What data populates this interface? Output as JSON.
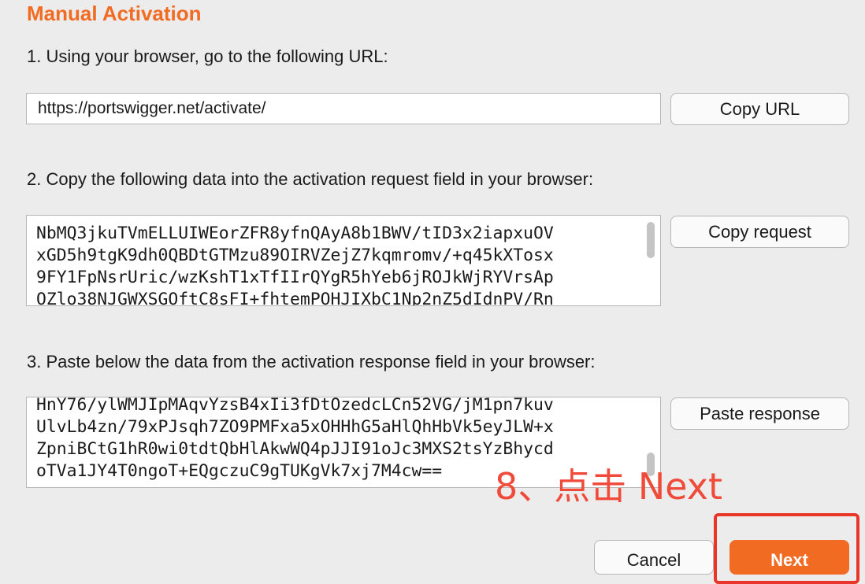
{
  "title": "Manual Activation",
  "step1": {
    "label": "1. Using your browser, go to the following URL:",
    "url_value": "https://portswigger.net/activate/",
    "copy_button": "Copy URL"
  },
  "step2": {
    "label": "2. Copy the following data into the activation request field in your browser:",
    "request_lines": [
      "NbMQ3jkuTVmELLUIWEorZFR8yfnQAyA8b1BWV/tID3x2iapxuOV",
      "xGD5h9tgK9dh0QBDtGTMzu89OIRVZejZ7kqmromv/+q45kXTosx",
      "9FY1FpNsrUric/wzKshT1xTfIIrQYgR5hYeb6jROJkWjRYVrsAp",
      "OZlo38NJGWXSGOftC8sFI+fhtemPOHJIXbC1Np2nZ5dIdnPV/Rn"
    ],
    "copy_button": "Copy request"
  },
  "step3": {
    "label": "3. Paste below the data from the activation response field in your browser:",
    "response_lines": [
      "HnY76/ylWMJIpMAqvYzsB4xIi3fDtOzedcLCn52VG/jM1pn7kuv",
      "UlvLb4zn/79xPJsqh7ZO9PMFxa5xOHHhG5aHlQhHbVk5eyJLW+x",
      "ZpniBCtG1hR0wi0tdtQbHlAkwWQ4pJJI91oJc3MXS2tsYzBhycd",
      "oTVa1JY4T0ngoT+EQgczuC9gTUKgVk7xj7M4cw=="
    ],
    "paste_button": "Paste response"
  },
  "annotation": "8、点击 Next",
  "footer": {
    "cancel_button": "Cancel",
    "next_button": "Next"
  },
  "colors": {
    "accent": "#f26b22",
    "annotation": "#f04a3a",
    "highlight_border": "#e8362a",
    "background": "#ececec"
  }
}
